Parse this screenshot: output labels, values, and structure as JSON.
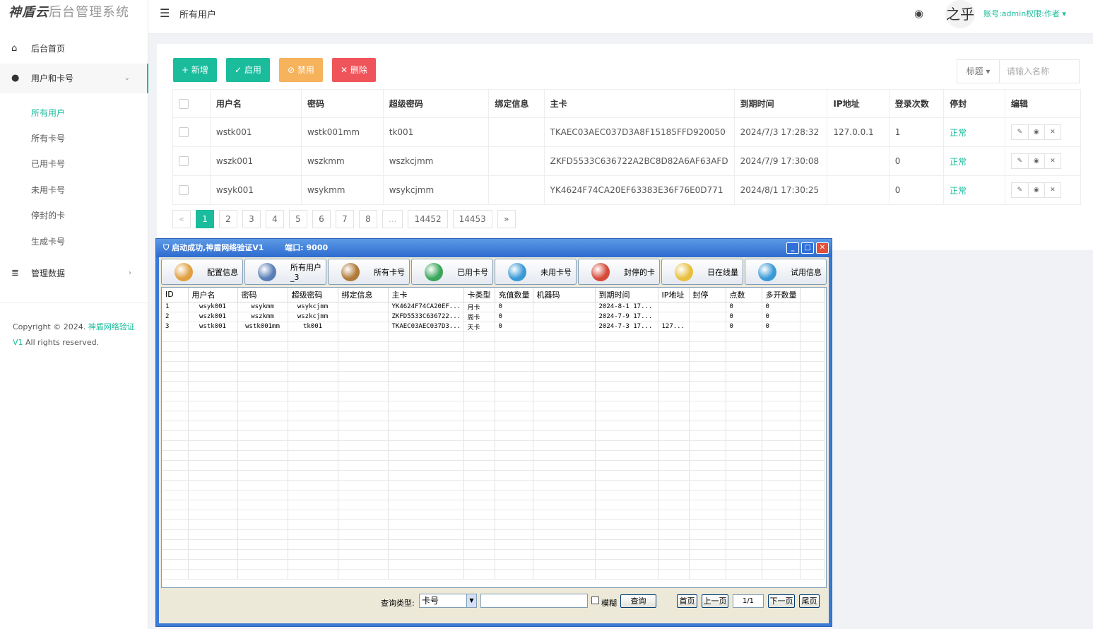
{
  "sidebar": {
    "logo_brand": "神盾云",
    "logo_text": "后台管理系统",
    "home": "后台首页",
    "users_cards": "用户和卡号",
    "sub_items": [
      "所有用户",
      "所有卡号",
      "已用卡号",
      "未用卡号",
      "停封的卡",
      "生成卡号"
    ],
    "manage_data": "管理数据",
    "copyright_prefix": "Copyright © 2024.",
    "copyright_link1": "神盾网络验证",
    "copyright_link2": "V1",
    "copyright_suffix": " All rights reserved."
  },
  "header": {
    "title": "所有用户",
    "avatar_text": "之乎",
    "account": "账号:admin权限:作者"
  },
  "toolbar": {
    "add": "+ 新增",
    "enable": "✓ 启用",
    "disable": "⊘ 禁用",
    "delete": "✕ 删除"
  },
  "search": {
    "field_label": "标题 ▾",
    "placeholder": "请输入名称"
  },
  "users_table": {
    "headers": [
      "用户名",
      "密码",
      "超级密码",
      "绑定信息",
      "主卡",
      "到期时间",
      "IP地址",
      "登录次数",
      "停封",
      "编辑"
    ],
    "rows": [
      {
        "username": "wstk001",
        "password": "wstk001mm",
        "super": "tk001",
        "bind": "",
        "card": "TKAEC03AEC037D3A8F15185FFD920050",
        "expire": "2024/7/3 17:28:32",
        "ip": "127.0.0.1",
        "logins": "1",
        "status": "正常"
      },
      {
        "username": "wszk001",
        "password": "wszkmm",
        "super": "wszkcjmm",
        "bind": "",
        "card": "ZKFD5533C636722A2BC8D82A6AF63AFD",
        "expire": "2024/7/9 17:30:08",
        "ip": "",
        "logins": "0",
        "status": "正常"
      },
      {
        "username": "wsyk001",
        "password": "wsykmm",
        "super": "wsykcjmm",
        "bind": "",
        "card": "YK4624F74CA20EF63383E36F76E0D771",
        "expire": "2024/8/1 17:30:25",
        "ip": "",
        "logins": "0",
        "status": "正常"
      }
    ]
  },
  "pager": {
    "prev": "«",
    "pages": [
      "1",
      "2",
      "3",
      "4",
      "5",
      "6",
      "7",
      "8",
      "...",
      "14452",
      "14453"
    ],
    "next": "»",
    "current": "1"
  },
  "window": {
    "title": "启动成功,神盾网络验证V1",
    "port": "端口:  9000",
    "buttons": [
      "配置信息",
      "所有用户_3",
      "所有卡号",
      "已用卡号",
      "未用卡号",
      "封停的卡",
      "日在线量",
      "试用信息"
    ],
    "icon_colors": [
      "#e0a040",
      "#5a7fb8",
      "#b07a3a",
      "#3aa65a",
      "#3a9ad6",
      "#d64a3a",
      "#e8c040",
      "#3a9ad6"
    ],
    "grid_headers": [
      "ID",
      "用户名",
      "密码",
      "超级密码",
      "绑定信息",
      "主卡",
      "卡类型",
      "充值数量",
      "机器码",
      "到期时间",
      "IP地址",
      "封停",
      "点数",
      "多开数量"
    ],
    "grid_rows": [
      [
        "1",
        "wsyk001",
        "wsykmm",
        "wsykcjmm",
        "",
        "YK4624F74CA20EF...",
        "月卡",
        "0",
        "",
        "2024-8-1 17...",
        "",
        "",
        "0",
        "0"
      ],
      [
        "2",
        "wszk001",
        "wszkmm",
        "wszkcjmm",
        "",
        "ZKFD5533C636722...",
        "周卡",
        "0",
        "",
        "2024-7-9 17...",
        "",
        "",
        "0",
        "0"
      ],
      [
        "3",
        "wstk001",
        "wstk001mm",
        "tk001",
        "",
        "TKAEC03AEC037D3...",
        "天卡",
        "0",
        "",
        "2024-7-3 17...",
        "127...",
        "",
        "0",
        "0"
      ]
    ],
    "query_label": "查询类型:",
    "query_type": "卡号",
    "fuzzy_label": "模糊",
    "query_btn": "查询",
    "first": "首页",
    "prev": "上一页",
    "page_num": "1/1",
    "next": "下一页",
    "last": "尾页"
  }
}
